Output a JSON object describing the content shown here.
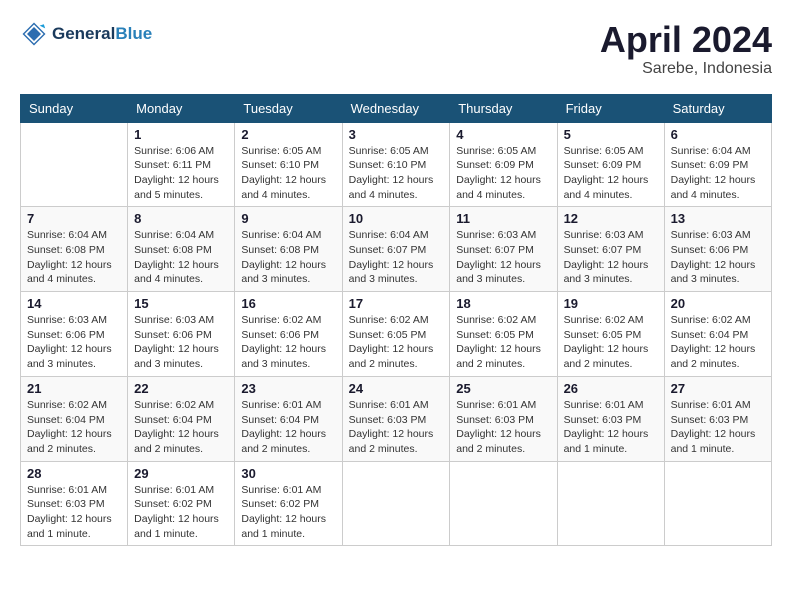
{
  "header": {
    "logo_line1": "General",
    "logo_line2": "Blue",
    "month": "April 2024",
    "location": "Sarebe, Indonesia"
  },
  "weekdays": [
    "Sunday",
    "Monday",
    "Tuesday",
    "Wednesday",
    "Thursday",
    "Friday",
    "Saturday"
  ],
  "weeks": [
    [
      null,
      {
        "day": 1,
        "sunrise": "6:06 AM",
        "sunset": "6:11 PM",
        "daylight": "12 hours and 5 minutes."
      },
      {
        "day": 2,
        "sunrise": "6:05 AM",
        "sunset": "6:10 PM",
        "daylight": "12 hours and 4 minutes."
      },
      {
        "day": 3,
        "sunrise": "6:05 AM",
        "sunset": "6:10 PM",
        "daylight": "12 hours and 4 minutes."
      },
      {
        "day": 4,
        "sunrise": "6:05 AM",
        "sunset": "6:09 PM",
        "daylight": "12 hours and 4 minutes."
      },
      {
        "day": 5,
        "sunrise": "6:05 AM",
        "sunset": "6:09 PM",
        "daylight": "12 hours and 4 minutes."
      },
      {
        "day": 6,
        "sunrise": "6:04 AM",
        "sunset": "6:09 PM",
        "daylight": "12 hours and 4 minutes."
      }
    ],
    [
      {
        "day": 7,
        "sunrise": "6:04 AM",
        "sunset": "6:08 PM",
        "daylight": "12 hours and 4 minutes."
      },
      {
        "day": 8,
        "sunrise": "6:04 AM",
        "sunset": "6:08 PM",
        "daylight": "12 hours and 4 minutes."
      },
      {
        "day": 9,
        "sunrise": "6:04 AM",
        "sunset": "6:08 PM",
        "daylight": "12 hours and 3 minutes."
      },
      {
        "day": 10,
        "sunrise": "6:04 AM",
        "sunset": "6:07 PM",
        "daylight": "12 hours and 3 minutes."
      },
      {
        "day": 11,
        "sunrise": "6:03 AM",
        "sunset": "6:07 PM",
        "daylight": "12 hours and 3 minutes."
      },
      {
        "day": 12,
        "sunrise": "6:03 AM",
        "sunset": "6:07 PM",
        "daylight": "12 hours and 3 minutes."
      },
      {
        "day": 13,
        "sunrise": "6:03 AM",
        "sunset": "6:06 PM",
        "daylight": "12 hours and 3 minutes."
      }
    ],
    [
      {
        "day": 14,
        "sunrise": "6:03 AM",
        "sunset": "6:06 PM",
        "daylight": "12 hours and 3 minutes."
      },
      {
        "day": 15,
        "sunrise": "6:03 AM",
        "sunset": "6:06 PM",
        "daylight": "12 hours and 3 minutes."
      },
      {
        "day": 16,
        "sunrise": "6:02 AM",
        "sunset": "6:06 PM",
        "daylight": "12 hours and 3 minutes."
      },
      {
        "day": 17,
        "sunrise": "6:02 AM",
        "sunset": "6:05 PM",
        "daylight": "12 hours and 2 minutes."
      },
      {
        "day": 18,
        "sunrise": "6:02 AM",
        "sunset": "6:05 PM",
        "daylight": "12 hours and 2 minutes."
      },
      {
        "day": 19,
        "sunrise": "6:02 AM",
        "sunset": "6:05 PM",
        "daylight": "12 hours and 2 minutes."
      },
      {
        "day": 20,
        "sunrise": "6:02 AM",
        "sunset": "6:04 PM",
        "daylight": "12 hours and 2 minutes."
      }
    ],
    [
      {
        "day": 21,
        "sunrise": "6:02 AM",
        "sunset": "6:04 PM",
        "daylight": "12 hours and 2 minutes."
      },
      {
        "day": 22,
        "sunrise": "6:02 AM",
        "sunset": "6:04 PM",
        "daylight": "12 hours and 2 minutes."
      },
      {
        "day": 23,
        "sunrise": "6:01 AM",
        "sunset": "6:04 PM",
        "daylight": "12 hours and 2 minutes."
      },
      {
        "day": 24,
        "sunrise": "6:01 AM",
        "sunset": "6:03 PM",
        "daylight": "12 hours and 2 minutes."
      },
      {
        "day": 25,
        "sunrise": "6:01 AM",
        "sunset": "6:03 PM",
        "daylight": "12 hours and 2 minutes."
      },
      {
        "day": 26,
        "sunrise": "6:01 AM",
        "sunset": "6:03 PM",
        "daylight": "12 hours and 1 minute."
      },
      {
        "day": 27,
        "sunrise": "6:01 AM",
        "sunset": "6:03 PM",
        "daylight": "12 hours and 1 minute."
      }
    ],
    [
      {
        "day": 28,
        "sunrise": "6:01 AM",
        "sunset": "6:03 PM",
        "daylight": "12 hours and 1 minute."
      },
      {
        "day": 29,
        "sunrise": "6:01 AM",
        "sunset": "6:02 PM",
        "daylight": "12 hours and 1 minute."
      },
      {
        "day": 30,
        "sunrise": "6:01 AM",
        "sunset": "6:02 PM",
        "daylight": "12 hours and 1 minute."
      },
      null,
      null,
      null,
      null
    ]
  ],
  "labels": {
    "sunrise_prefix": "Sunrise: ",
    "sunset_prefix": "Sunset: ",
    "daylight_prefix": "Daylight: "
  }
}
